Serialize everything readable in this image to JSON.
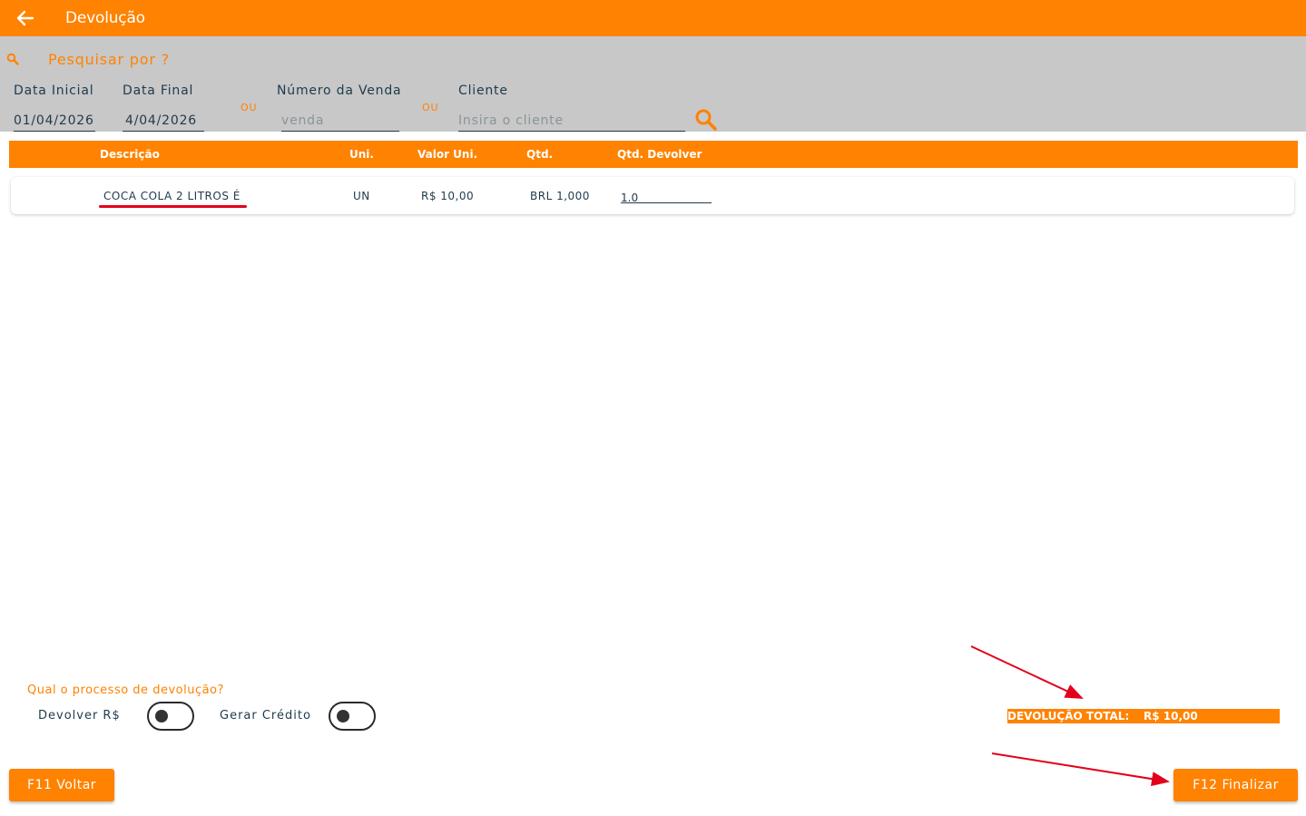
{
  "appbar": {
    "title": "Devolução",
    "back_icon": "arrow-left-icon"
  },
  "search": {
    "prompt": "Pesquisar por ?",
    "date_start": {
      "label": "Data Inicial",
      "value": "01/04/2026"
    },
    "date_end": {
      "label": "Data Final",
      "value": "4/04/2026"
    },
    "separator": "OU",
    "sale_number": {
      "label": "Número da Venda",
      "placeholder": "venda",
      "value": ""
    },
    "client": {
      "label": "Cliente",
      "placeholder": "Insira o cliente",
      "value": ""
    },
    "search_icon": "magnifier-icon"
  },
  "table": {
    "columns": [
      "Descrição",
      "Uni.",
      "Valor Uni.",
      "Qtd.",
      "Qtd. Devolver"
    ],
    "rows": [
      {
        "description": "COCA COLA 2 LITROS É",
        "unit": "UN",
        "unit_price": "R$ 10,00",
        "qty": "BRL 1,000",
        "qty_return": "1.0"
      }
    ]
  },
  "return_process": {
    "question": "Qual o processo de devolução?",
    "options": [
      {
        "label": "Devolver R$",
        "enabled": false
      },
      {
        "label": "Gerar Crédito",
        "enabled": false
      }
    ]
  },
  "total": {
    "label": "DEVOLUÇÃO TOTAL:",
    "value": "R$ 10,00"
  },
  "buttons": {
    "back": "F11 Voltar",
    "finish": "F12 Finalizar"
  },
  "colors": {
    "accent": "#ff8200",
    "panel": "#c8c8c8",
    "text": "#1f3a4d",
    "annotation": "#e3001b"
  }
}
